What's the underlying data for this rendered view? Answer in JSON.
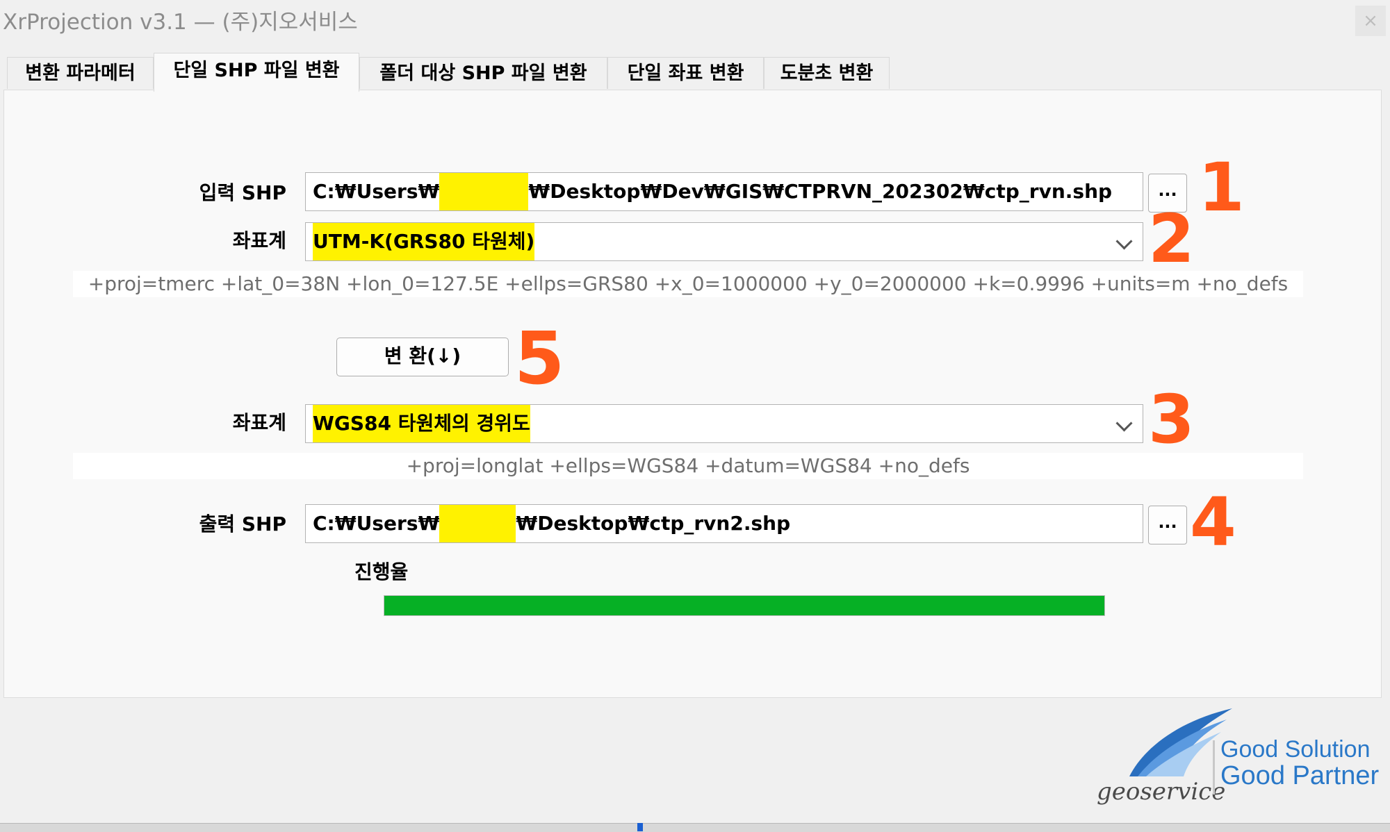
{
  "window": {
    "title": "XrProjection v3.1 — (주)지오서비스",
    "close_glyph": "×"
  },
  "tabs": [
    {
      "label": "변환 파라메터"
    },
    {
      "label": "단일 SHP 파일 변환"
    },
    {
      "label": "폴더 대상 SHP 파일 변환"
    },
    {
      "label": "단일 좌표 변환"
    },
    {
      "label": "도분초 변환"
    }
  ],
  "active_tab": "단일 SHP 파일 변환",
  "input_shp": {
    "label": "입력 SHP",
    "value_prefix": "C:₩Users₩",
    "value_suffix": "₩Desktop₩Dev₩GIS₩CTPRVN_202302₩ctp_rvn.shp",
    "browse_label": "..."
  },
  "source_crs": {
    "label": "좌표계",
    "selected": "UTM-K(GRS80 타원체)",
    "proj4": "+proj=tmerc +lat_0=38N +lon_0=127.5E +ellps=GRS80 +x_0=1000000 +y_0=2000000 +k=0.9996 +units=m +no_defs"
  },
  "convert_button": {
    "label": "변 환(↓)"
  },
  "target_crs": {
    "label": "좌표계",
    "selected": "WGS84 타원체의 경위도",
    "proj4": "+proj=longlat +ellps=WGS84 +datum=WGS84 +no_defs"
  },
  "output_shp": {
    "label": "출력 SHP",
    "value_prefix": "C:₩Users₩",
    "value_suffix": "₩Desktop₩ctp_rvn2.shp",
    "browse_label": "..."
  },
  "progress": {
    "label": "진행율",
    "fraction": 1.0,
    "color": "#06b025"
  },
  "annotations": [
    "1",
    "2",
    "3",
    "4",
    "5"
  ],
  "annotation_color": "#ff5a1a",
  "highlight_color": "#fff200",
  "logo": {
    "brand": "geoservice",
    "line1": "Good Solution",
    "line2": "Good Partner"
  }
}
